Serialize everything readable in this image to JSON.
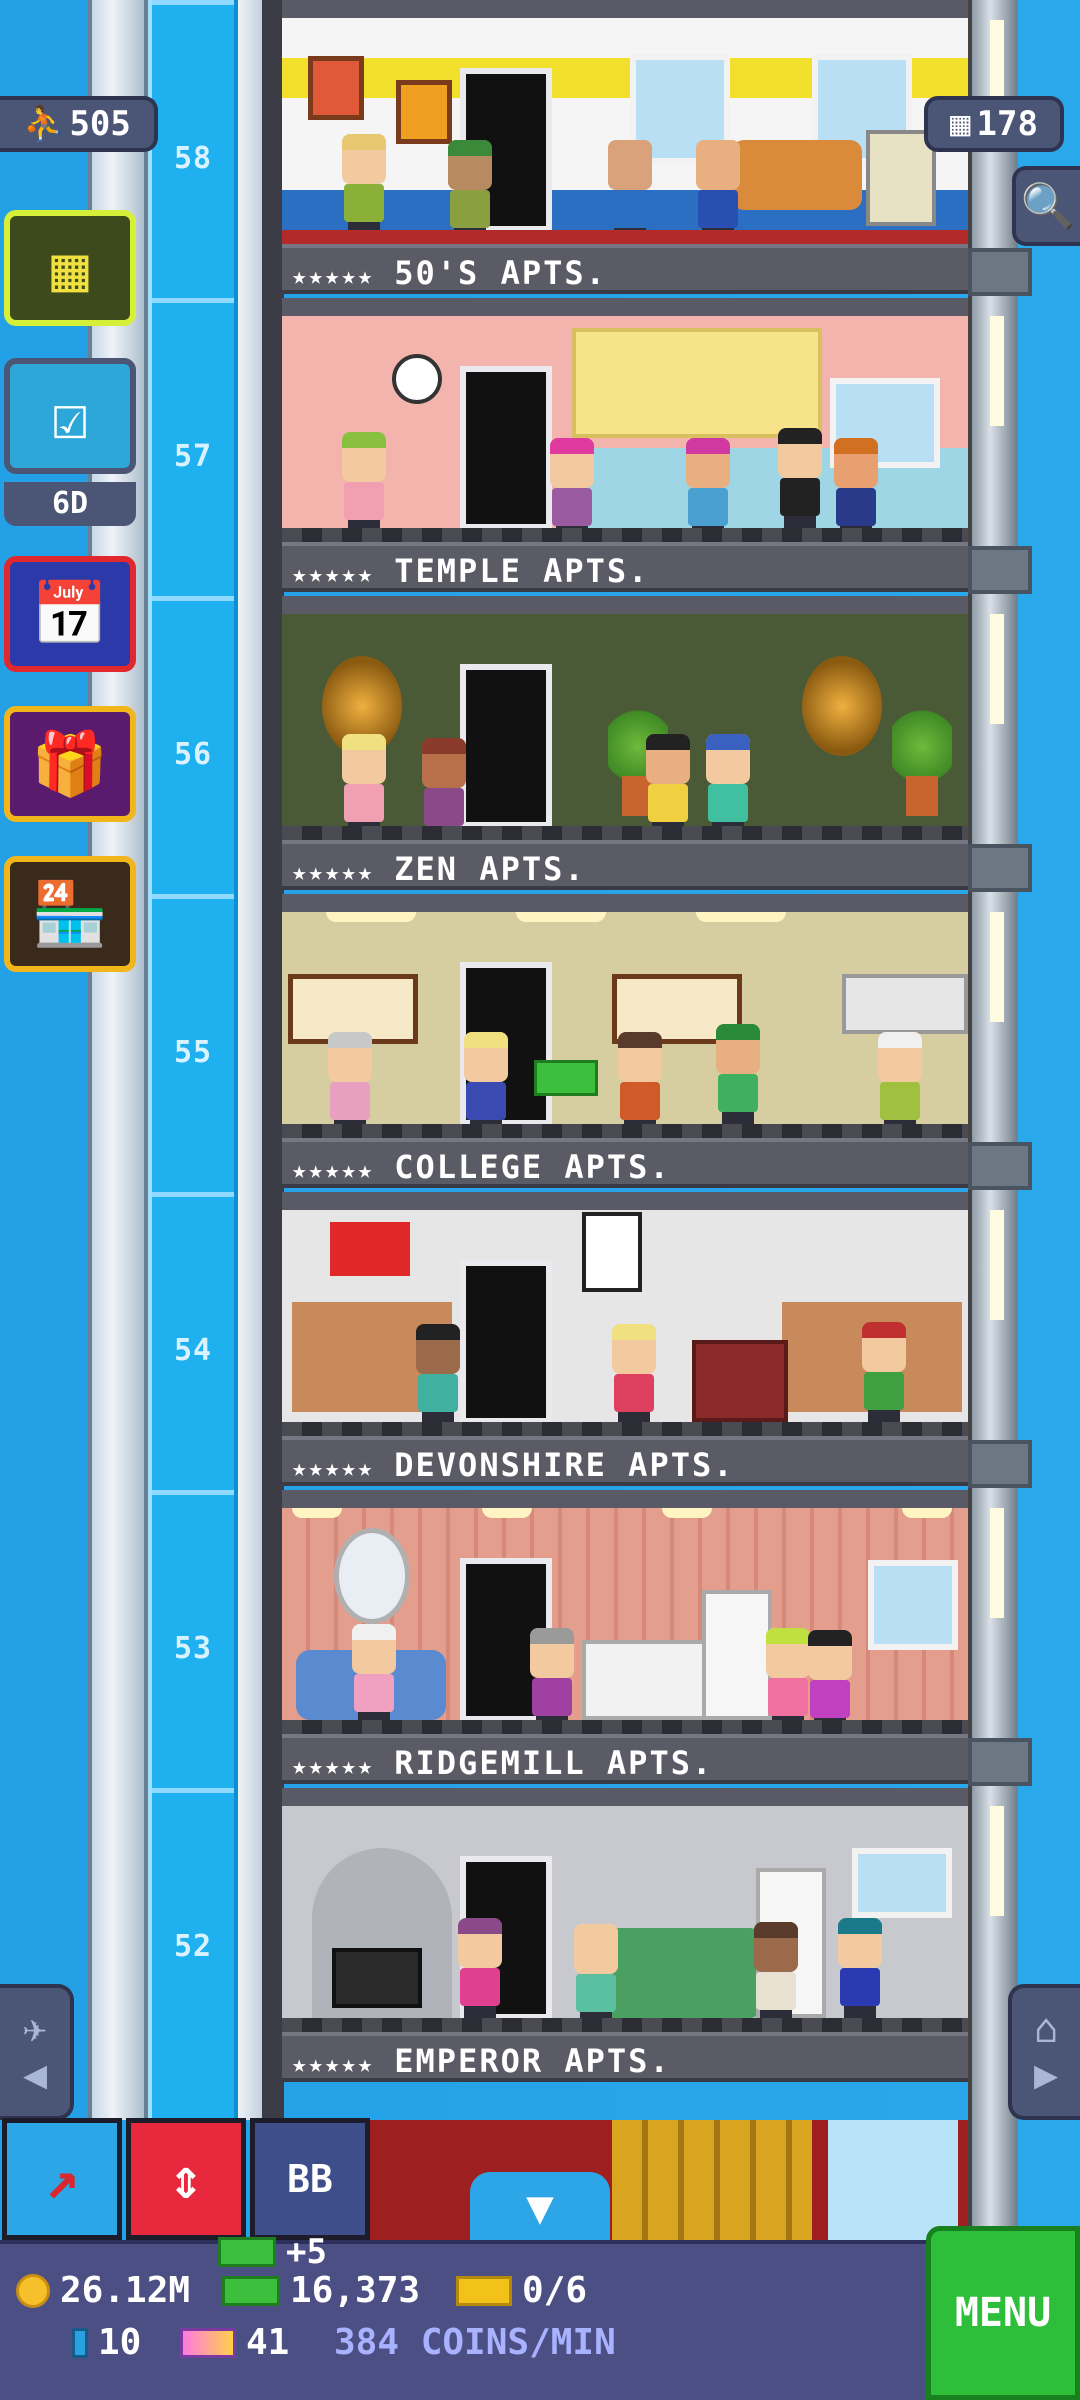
{
  "hud_top": {
    "population": "505",
    "bits": "178"
  },
  "left_menu": {
    "quest_timer": "6D"
  },
  "floors": [
    {
      "number": "58",
      "name": "50'S APTS.",
      "wall": "#f5f5f5",
      "accent": "#f3e02c",
      "floor_color": "#b22a2a"
    },
    {
      "number": "57",
      "name": "TEMPLE APTS.",
      "wall": "#f2b4ad",
      "accent": "#f7e38a",
      "floor_color": "#4a4a52"
    },
    {
      "number": "56",
      "name": "ZEN APTS.",
      "wall": "#4b5a36",
      "accent": "#3a4a2a",
      "floor_color": "#2c2c34"
    },
    {
      "number": "55",
      "name": "COLLEGE APTS.",
      "wall": "#d6cda0",
      "accent": "#b8ac7a",
      "floor_color": "#4a4a52"
    },
    {
      "number": "54",
      "name": "DEVONSHIRE APTS.",
      "wall": "#e6e6e6",
      "accent": "#d0d0d0",
      "floor_color": "#4a4a52"
    },
    {
      "number": "53",
      "name": "RIDGEMILL APTS.",
      "wall": "#e49e8e",
      "accent": "#c97a6c",
      "floor_color": "#2c2c34"
    },
    {
      "number": "52",
      "name": "EMPEROR APTS.",
      "wall": "#c7c9cf",
      "accent": "#b0b3ba",
      "floor_color": "#4a4a52"
    }
  ],
  "stars": "★★★★★",
  "toolbar": {
    "bb_label": "BB"
  },
  "hud_bottom": {
    "bux_gain": "+5",
    "coins": "26.12M",
    "bux": "16,373",
    "tickets": "0/6",
    "bits_count": "10",
    "vip": "41",
    "rate": "384 COINS/MIN",
    "menu_label": "MENU"
  }
}
